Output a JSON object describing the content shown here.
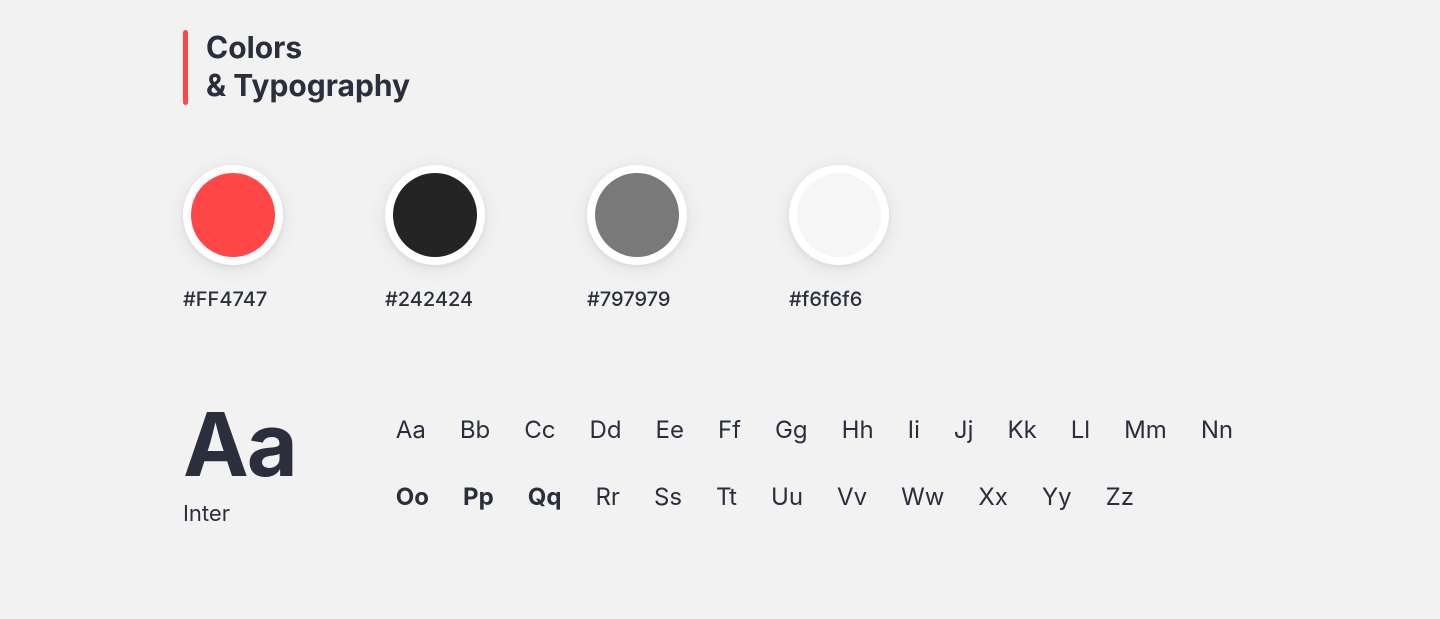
{
  "header": {
    "line1": "Colors",
    "line2": "& Typography"
  },
  "colors": [
    {
      "hex": "#FF4747",
      "label": "#FF4747"
    },
    {
      "hex": "#242424",
      "label": "#242424"
    },
    {
      "hex": "#797979",
      "label": "#797979"
    },
    {
      "hex": "#f6f6f6",
      "label": "#f6f6f6"
    }
  ],
  "typography": {
    "sample": "Aa",
    "fontName": "Inter",
    "row1": [
      "Aa",
      "Bb",
      "Cc",
      "Dd",
      "Ee",
      "Ff",
      "Gg",
      "Hh",
      "Ii",
      "Jj",
      "Kk",
      "Ll",
      "Mm",
      "Nn"
    ],
    "row2": [
      "Oo",
      "Pp",
      "Qq",
      "Rr",
      "Ss",
      "Tt",
      "Uu",
      "Vv",
      "Ww",
      "Xx",
      "Yy",
      "Zz"
    ]
  }
}
